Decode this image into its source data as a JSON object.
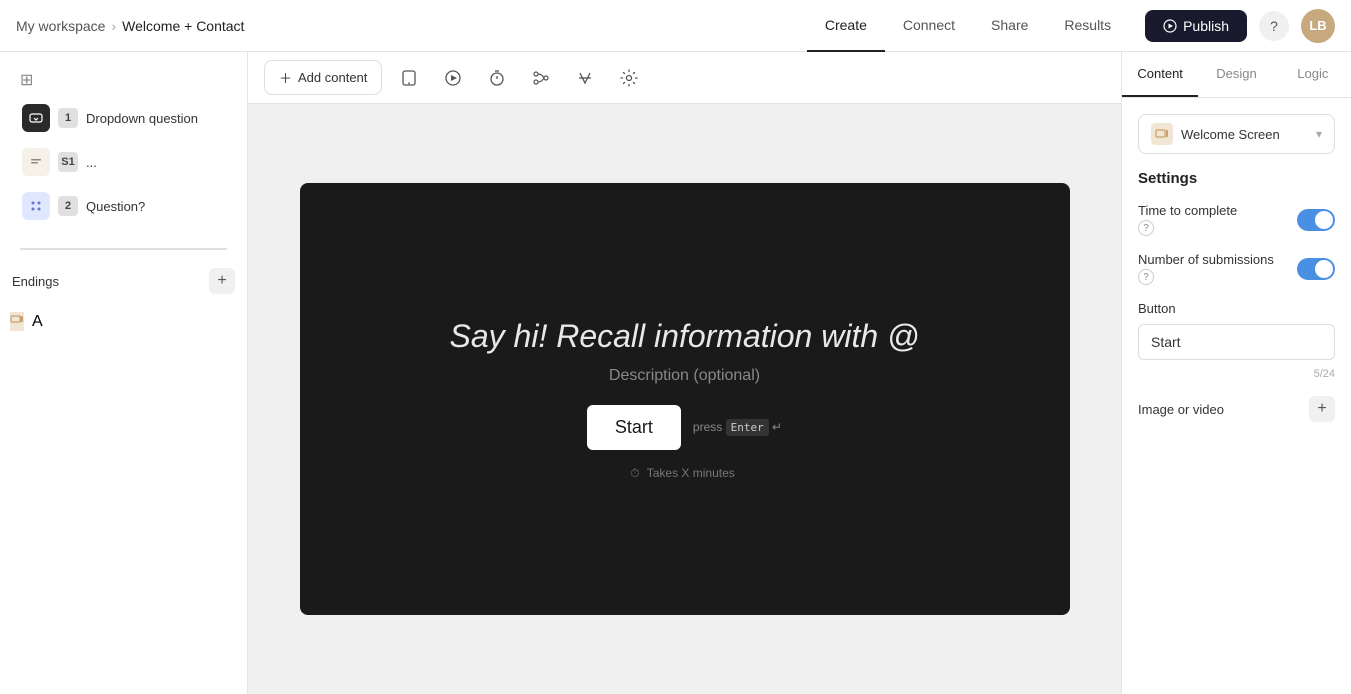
{
  "breadcrumb": {
    "workspace": "My workspace",
    "separator": "›",
    "project": "Welcome + Contact"
  },
  "nav": {
    "tabs": [
      "Create",
      "Connect",
      "Share",
      "Results"
    ],
    "active_tab": "Create"
  },
  "topbar": {
    "publish_label": "Publish",
    "avatar_initials": "LB",
    "help_icon": "?"
  },
  "sidebar": {
    "top_icon": "grid-icon",
    "items": [
      {
        "num": "1",
        "label": "Dropdown question",
        "type": "dropdown"
      },
      {
        "num": "S1",
        "label": "...",
        "type": "statement"
      },
      {
        "num": "2",
        "label": "Question?",
        "type": "multi"
      }
    ],
    "endings_label": "Endings",
    "endings_items": [
      {
        "label": "A",
        "type": "ending"
      }
    ]
  },
  "canvas": {
    "add_content_label": "Add content",
    "form_title": "Say hi! Recall information with @",
    "form_description": "Description (optional)",
    "start_button": "Start",
    "press_hint": "press Enter ↵",
    "takes_time": "Takes X minutes"
  },
  "right_panel": {
    "tabs": [
      "Content",
      "Design",
      "Logic"
    ],
    "active_tab": "Content",
    "screen_selector": "Welcome Screen",
    "settings_title": "Settings",
    "time_to_complete_label": "Time to complete",
    "time_to_complete_on": true,
    "num_submissions_label": "Number of submissions",
    "num_submissions_on": true,
    "button_section_label": "Button",
    "button_value": "Start",
    "button_char_count": "5/24",
    "image_or_video_label": "Image or video"
  }
}
